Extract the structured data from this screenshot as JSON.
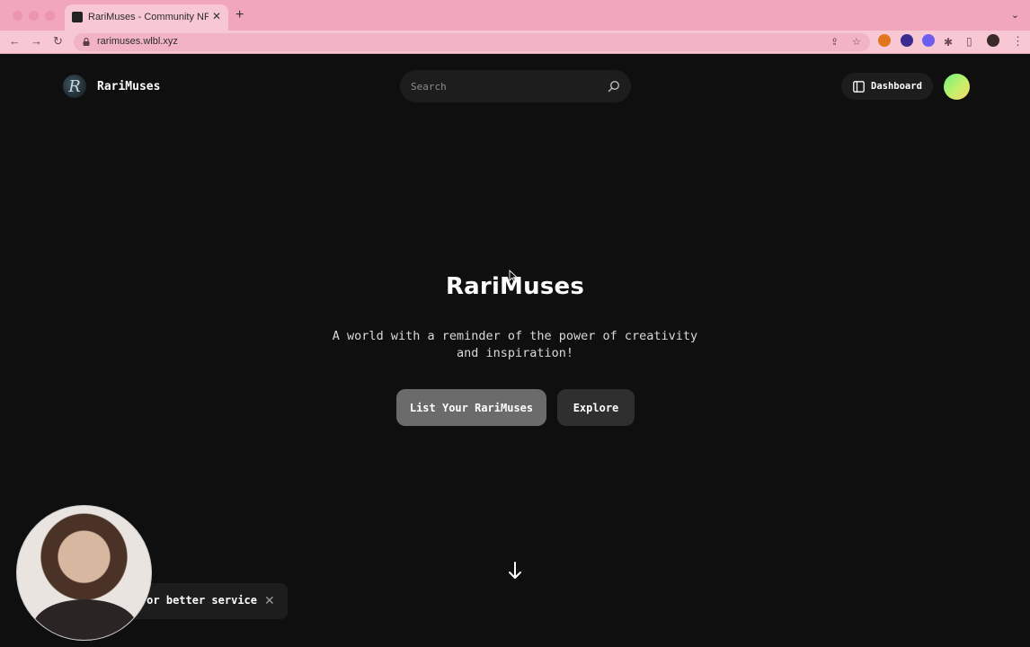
{
  "browser": {
    "tab_title": "RariMuses - Community NFT M",
    "tab_close": "✕",
    "new_tab": "+",
    "url": "rarimuses.wlbl.xyz"
  },
  "header": {
    "logo_letter": "R",
    "brand_name": "RariMuses",
    "search_placeholder": "Search",
    "dashboard_label": "Dashboard"
  },
  "hero": {
    "title": "RariMuses",
    "subtitle": "A world with a reminder of the power of creativity and inspiration!",
    "primary_button": "List Your RariMuses",
    "secondary_button": "Explore"
  },
  "toast": {
    "text": "or better service",
    "close": "✕"
  },
  "colors": {
    "tab_bar": "#f2a6bb",
    "page_bg": "#0f0f0f",
    "primary_button": "#6b6b6b",
    "secondary_button": "#2f2f2f"
  }
}
